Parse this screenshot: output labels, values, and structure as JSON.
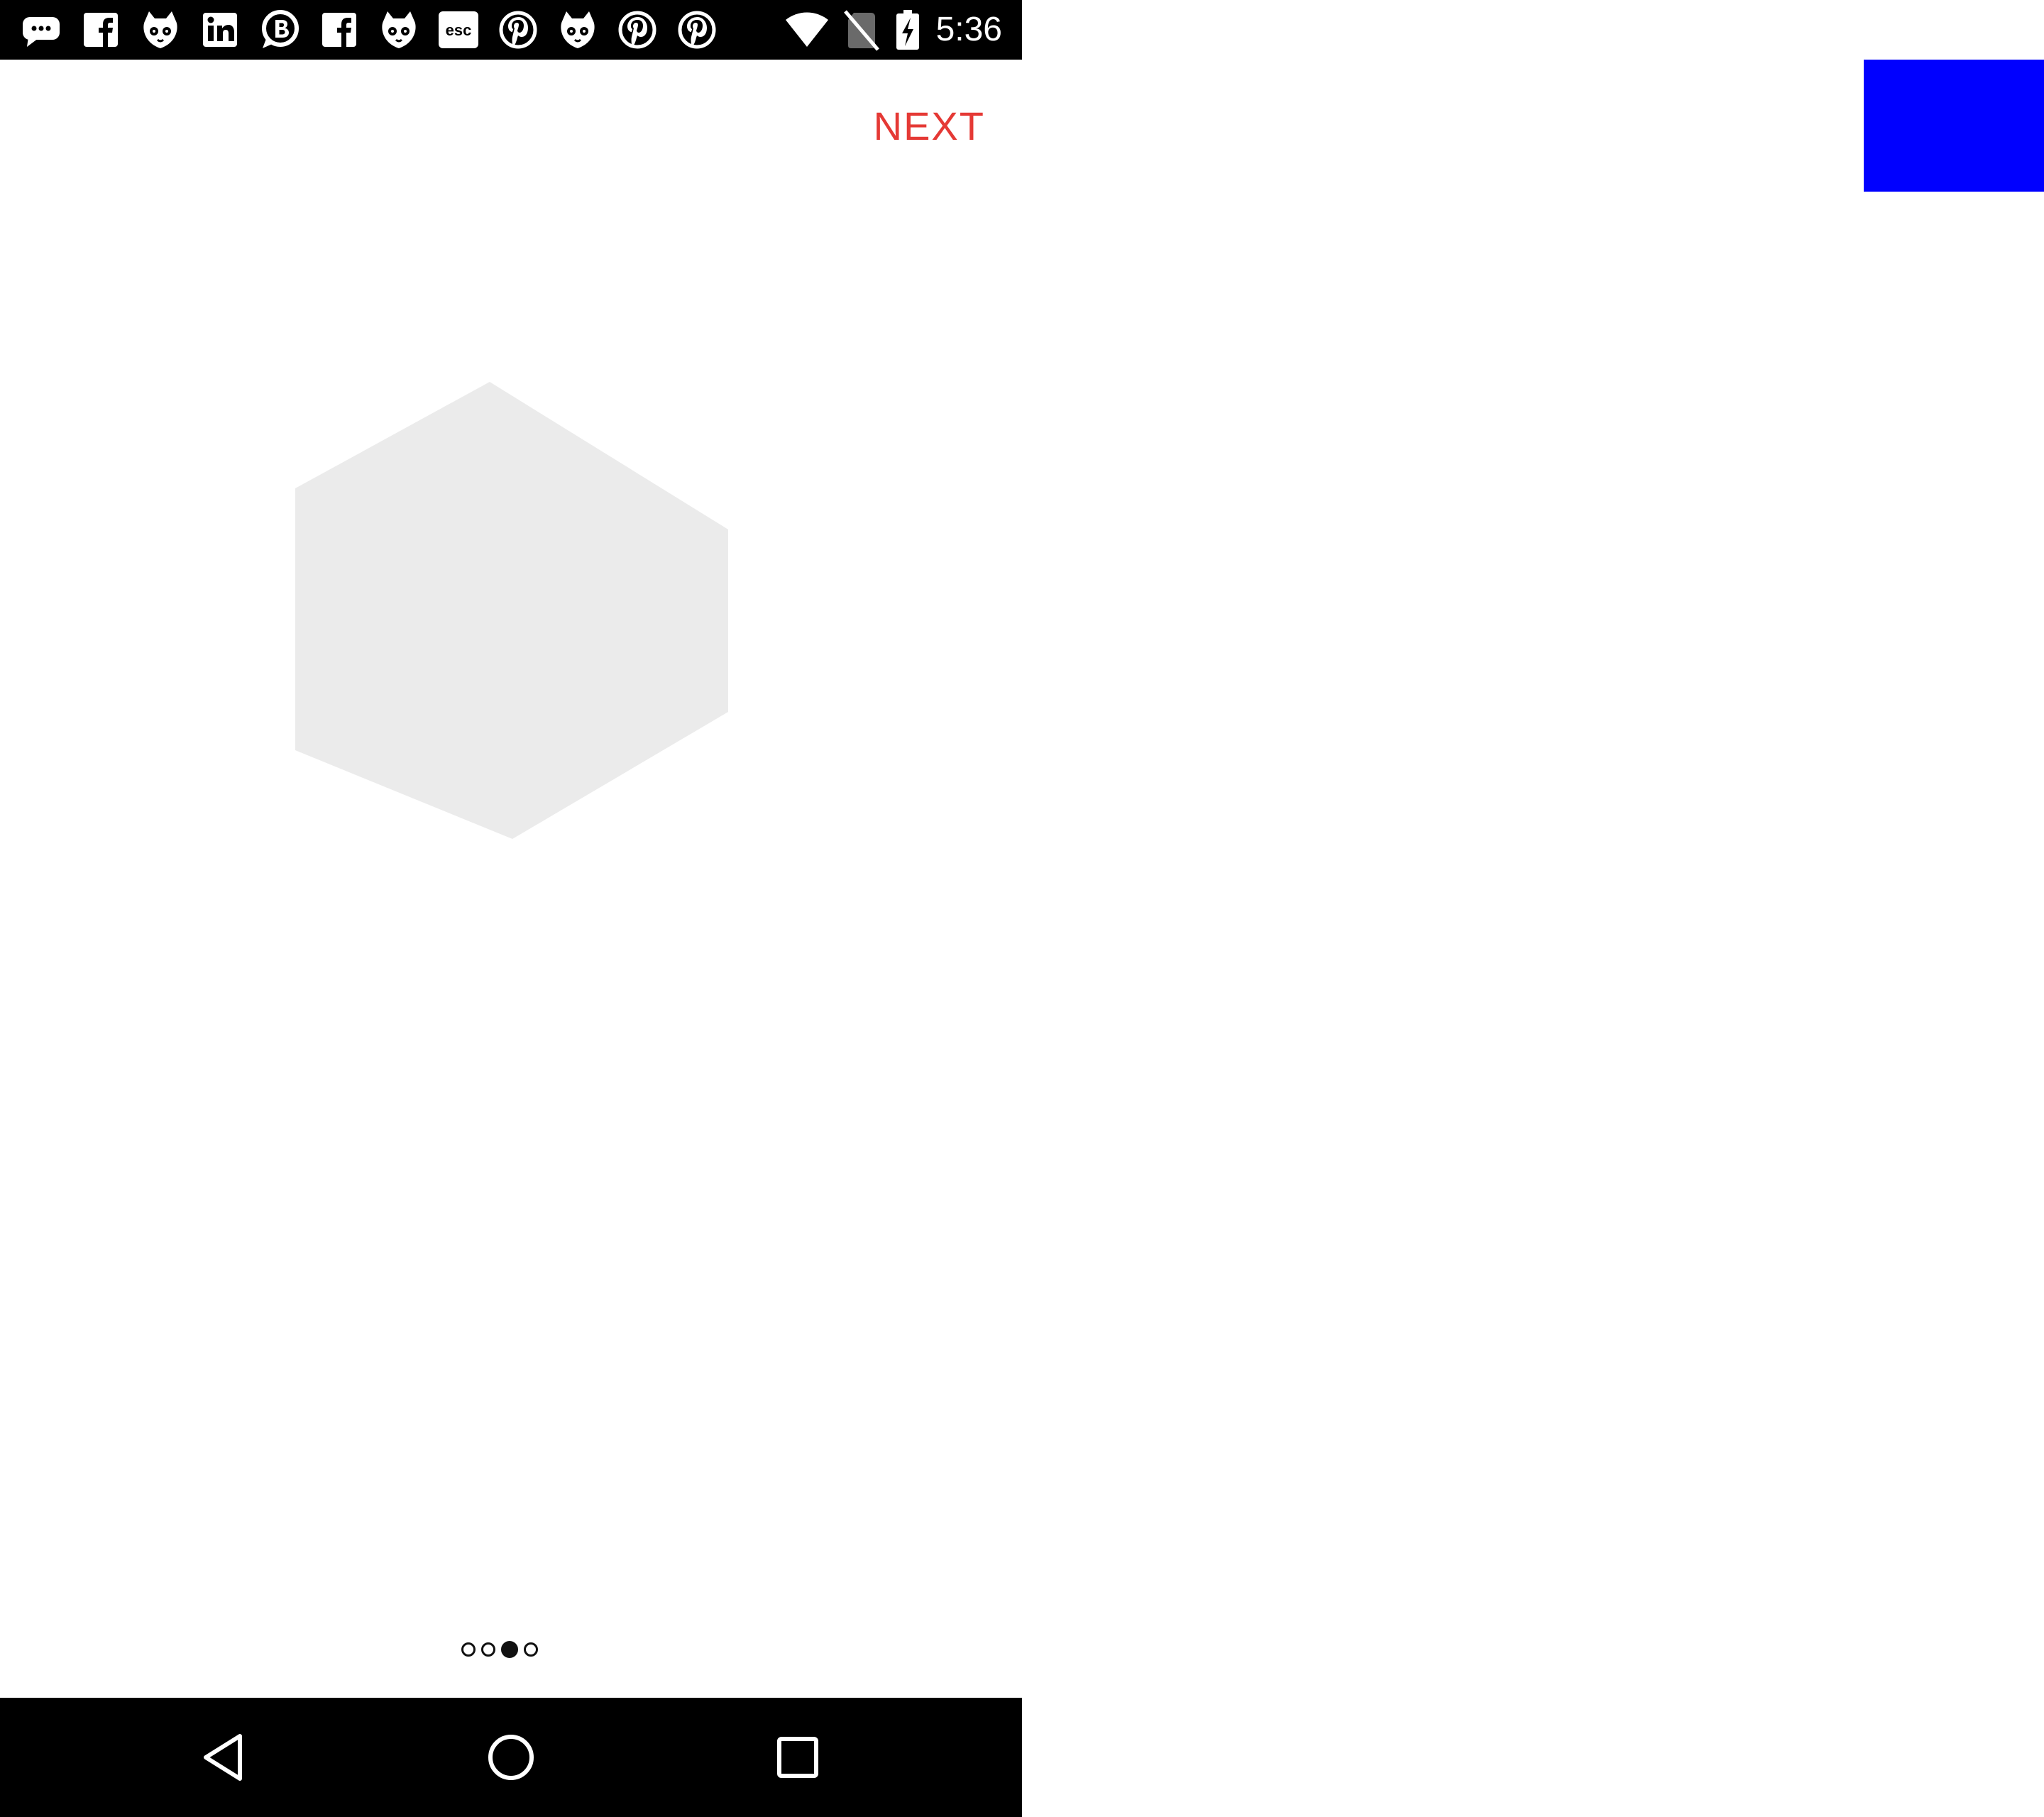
{
  "status_bar": {
    "notification_icons": [
      "chat-bubble-icon",
      "facebook-icon",
      "cat-face-icon",
      "linkedin-icon",
      "b-bubble-icon",
      "facebook-icon",
      "cat-face-icon",
      "esc-icon",
      "pinterest-icon",
      "cat-face-icon",
      "pinterest-icon",
      "pinterest-icon"
    ],
    "system_icons": [
      "wifi-icon",
      "no-sim-icon",
      "battery-charging-icon"
    ],
    "esc_label": "esc",
    "clock": "5:36"
  },
  "toolbar": {
    "next_label": "NEXT"
  },
  "hero": {
    "icon": "hexagon-placeholder",
    "color": "#ebebeb"
  },
  "pager": {
    "total": 4,
    "active_index": 2
  },
  "nav_bar": {
    "buttons": [
      "back-icon",
      "home-icon",
      "recents-icon"
    ]
  },
  "colors": {
    "accent": "#e53935",
    "blue_block": "#0000ff",
    "bar_background": "#000000"
  }
}
